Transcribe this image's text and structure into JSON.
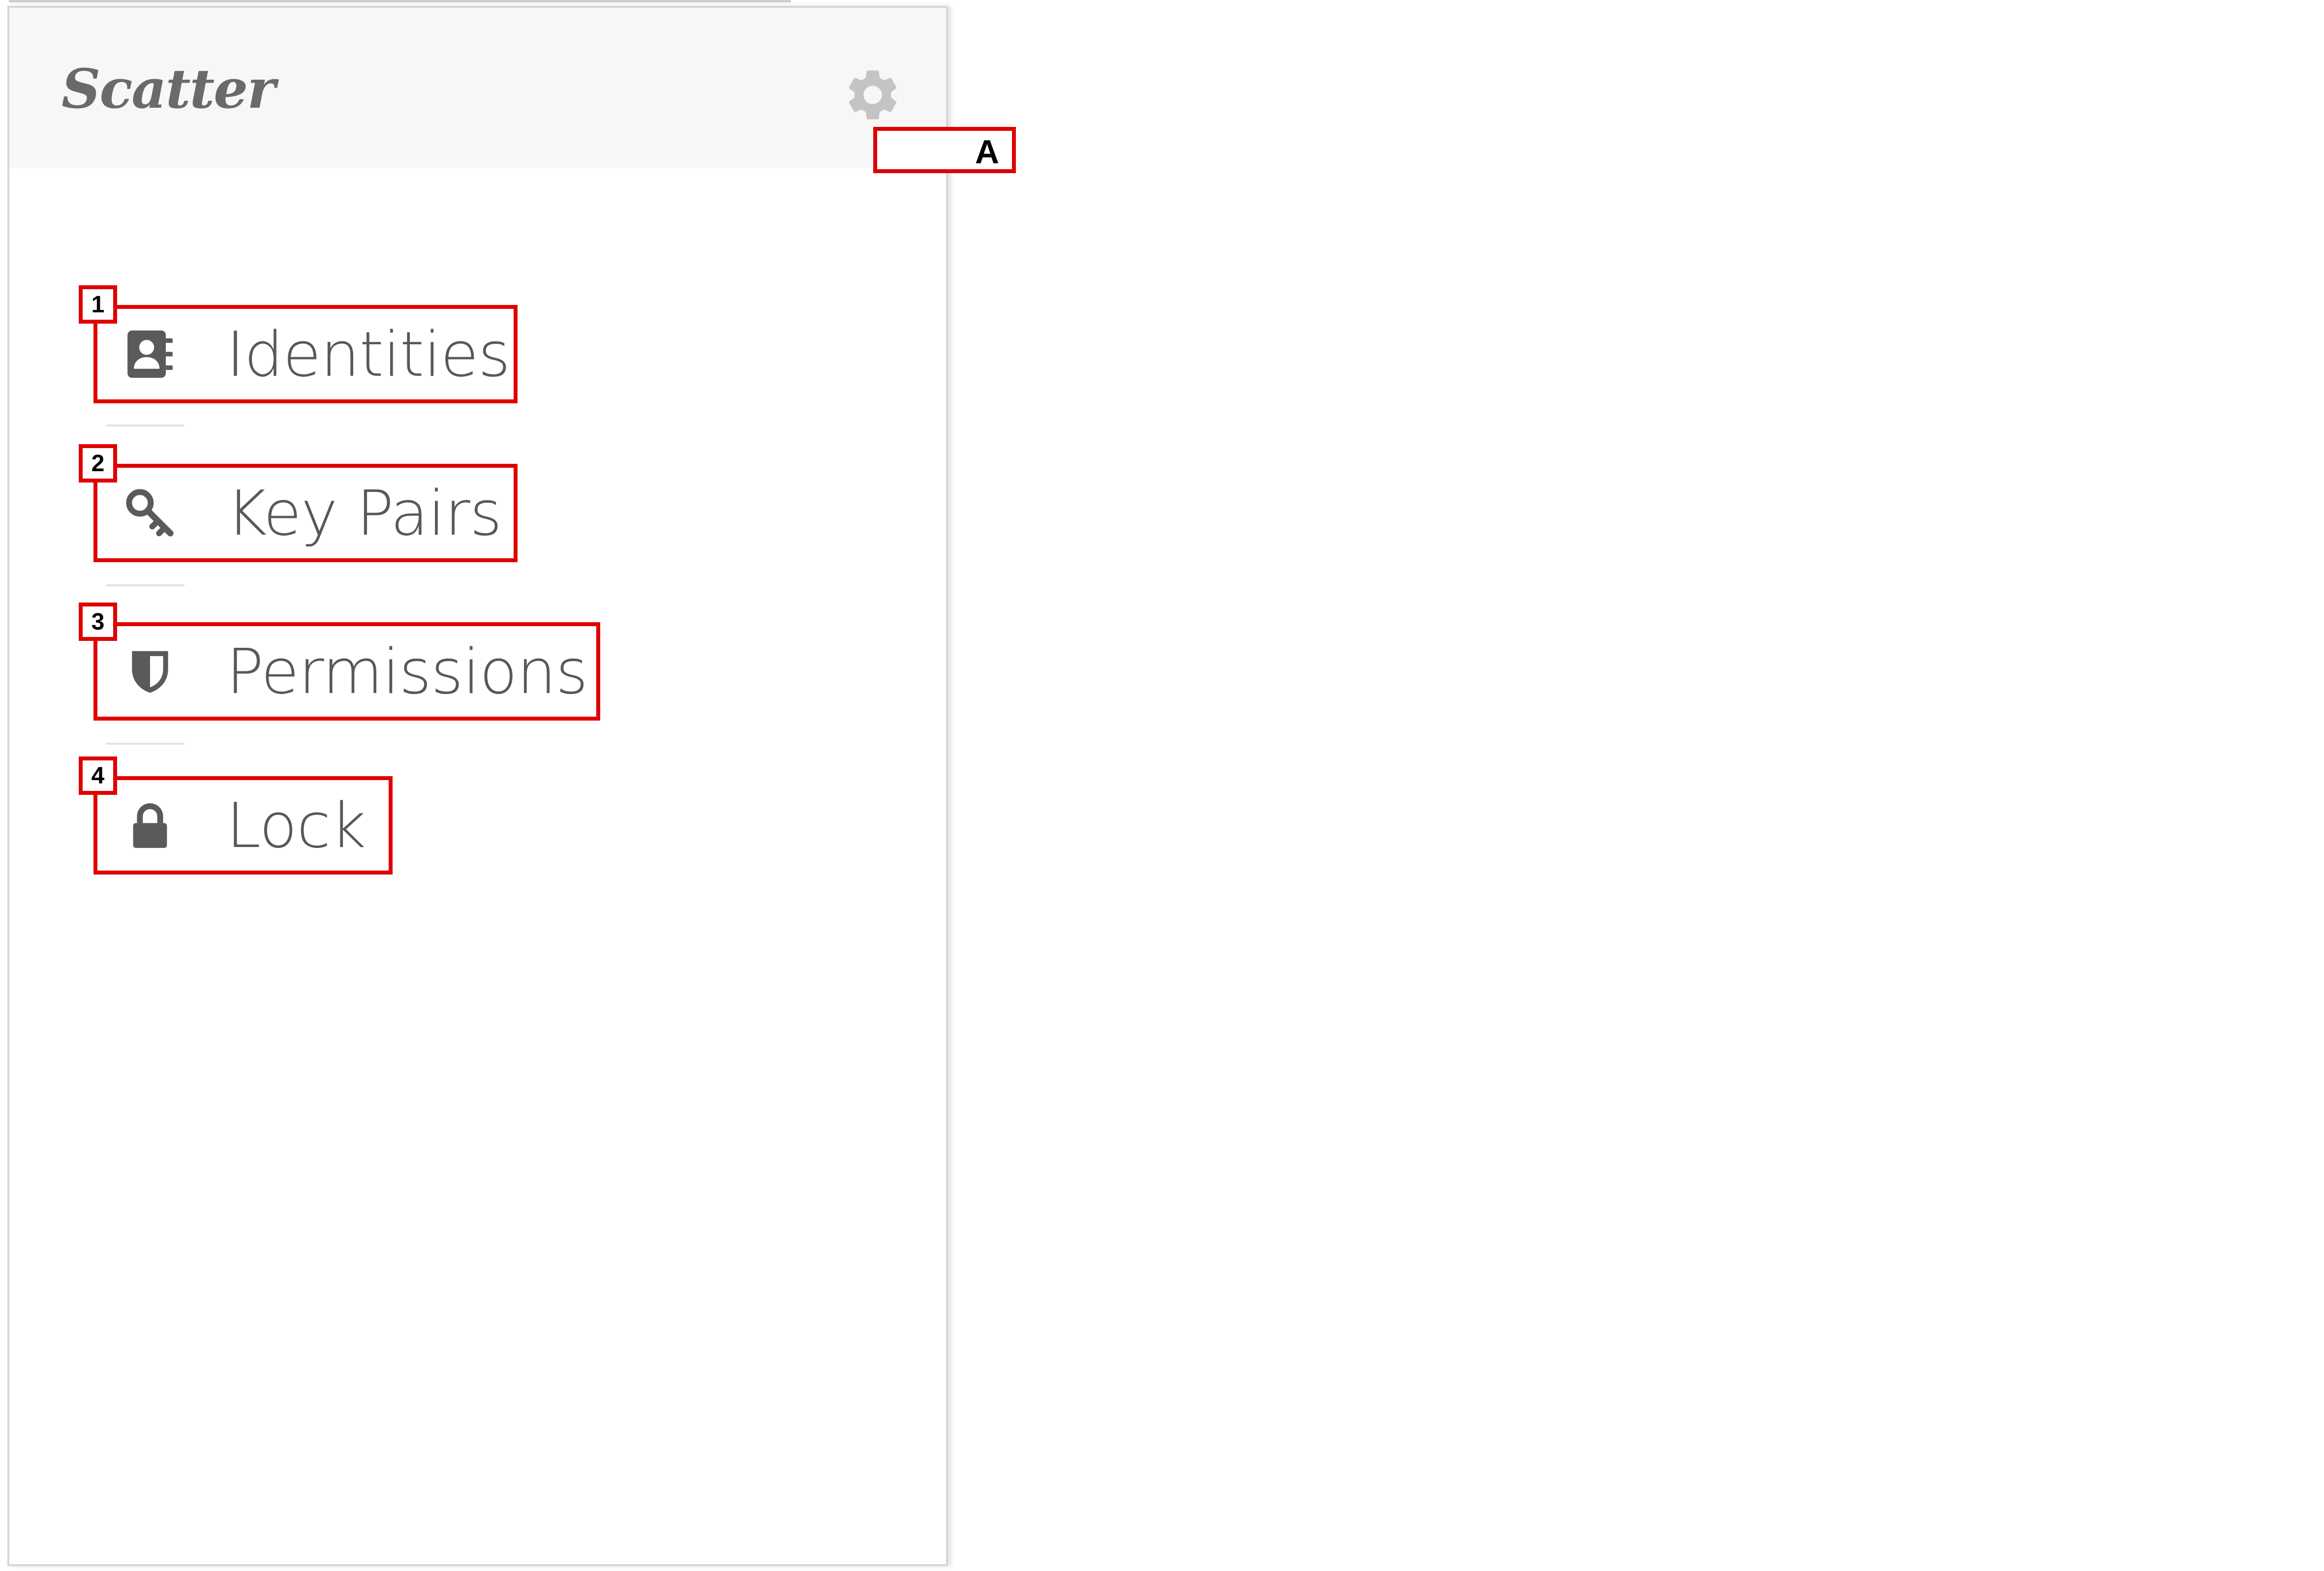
{
  "app": {
    "logo_text": "Scatter",
    "settings_icon": "gear-icon"
  },
  "menu": {
    "items": [
      {
        "label": "Identities",
        "icon": "contact-book-icon",
        "tag": "1"
      },
      {
        "label": "Key Pairs",
        "icon": "key-icon",
        "tag": "2"
      },
      {
        "label": "Permissions",
        "icon": "shield-icon",
        "tag": "3"
      },
      {
        "label": "Lock",
        "icon": "lock-icon",
        "tag": "4"
      }
    ]
  },
  "annotations": {
    "settings_tag": "A"
  },
  "colors": {
    "header_bg": "#f7f7f7",
    "text": "#585858",
    "icon": "#5a5a5a",
    "gear": "#c4c4c4",
    "annotation": "#e00000"
  }
}
